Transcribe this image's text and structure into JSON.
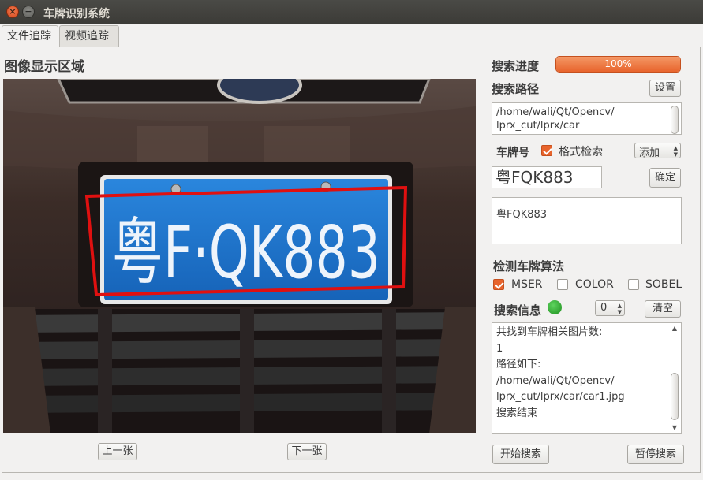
{
  "window": {
    "title": "车牌识别系统",
    "close_glyph": "×",
    "minimize_glyph": "−"
  },
  "tabs": [
    {
      "label": "文件追踪"
    },
    {
      "label": "视频追踪"
    }
  ],
  "image_panel": {
    "title": "图像显示区域",
    "plate_text": "粤F·QK883",
    "prev_button": "上一张",
    "next_button": "下一张"
  },
  "search": {
    "progress_label": "搜索进度",
    "progress_value": 100,
    "progress_text": "100%",
    "path_label": "搜索路径",
    "path_button": "设置",
    "path_value": "/home/wali/Qt/Opencv/\nlprx_cut/lprx/car"
  },
  "plate": {
    "label": "车牌号",
    "format_check_label": "格式检索",
    "format_check_checked": true,
    "add_combo": "添加",
    "input_value": "粤FQK883",
    "confirm_button": "确定",
    "list_items": [
      "粤FQK883"
    ]
  },
  "algorithm": {
    "title": "检测车牌算法",
    "options": [
      {
        "label": "MSER",
        "checked": true
      },
      {
        "label": "COLOR",
        "checked": false
      },
      {
        "label": "SOBEL",
        "checked": false
      }
    ]
  },
  "info": {
    "label": "搜索信息",
    "status_color": "#2fa32f",
    "spin_value": "0",
    "clear_button": "清空",
    "log_text": "共找到车牌相关图片数:\n1\n路径如下:\n/home/wali/Qt/Opencv/\nlprx_cut/lprx/car/car1.jpg\n搜索结束"
  },
  "actions": {
    "start_button": "开始搜索",
    "pause_button": "暂停搜索"
  },
  "colors": {
    "accent": "#e8642c",
    "plate_blue": "#1f6fc8",
    "detect_box": "#e01010"
  }
}
